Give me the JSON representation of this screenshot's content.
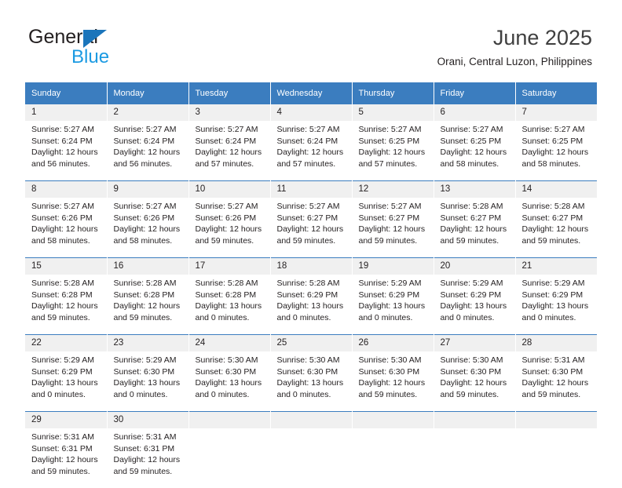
{
  "logo": {
    "word_primary": "General",
    "word_secondary": "Blue",
    "triangle_icon": "triangle-icon",
    "primary_color": "#231f20",
    "secondary_color": "#1b9ae2",
    "triangle_color": "#1b75bb"
  },
  "header": {
    "title": "June 2025",
    "subtitle": "Orani, Central Luzon, Philippines"
  },
  "theme": {
    "header_blue": "#3b7dbf",
    "daynum_gray": "#f0f0f0",
    "text": "#231f20"
  },
  "weekday_headers": [
    "Sunday",
    "Monday",
    "Tuesday",
    "Wednesday",
    "Thursday",
    "Friday",
    "Saturday"
  ],
  "weeks": [
    [
      {
        "day": "1",
        "sunrise": "Sunrise: 5:27 AM",
        "sunset": "Sunset: 6:24 PM",
        "daylight": "Daylight: 12 hours and 56 minutes."
      },
      {
        "day": "2",
        "sunrise": "Sunrise: 5:27 AM",
        "sunset": "Sunset: 6:24 PM",
        "daylight": "Daylight: 12 hours and 56 minutes."
      },
      {
        "day": "3",
        "sunrise": "Sunrise: 5:27 AM",
        "sunset": "Sunset: 6:24 PM",
        "daylight": "Daylight: 12 hours and 57 minutes."
      },
      {
        "day": "4",
        "sunrise": "Sunrise: 5:27 AM",
        "sunset": "Sunset: 6:24 PM",
        "daylight": "Daylight: 12 hours and 57 minutes."
      },
      {
        "day": "5",
        "sunrise": "Sunrise: 5:27 AM",
        "sunset": "Sunset: 6:25 PM",
        "daylight": "Daylight: 12 hours and 57 minutes."
      },
      {
        "day": "6",
        "sunrise": "Sunrise: 5:27 AM",
        "sunset": "Sunset: 6:25 PM",
        "daylight": "Daylight: 12 hours and 58 minutes."
      },
      {
        "day": "7",
        "sunrise": "Sunrise: 5:27 AM",
        "sunset": "Sunset: 6:25 PM",
        "daylight": "Daylight: 12 hours and 58 minutes."
      }
    ],
    [
      {
        "day": "8",
        "sunrise": "Sunrise: 5:27 AM",
        "sunset": "Sunset: 6:26 PM",
        "daylight": "Daylight: 12 hours and 58 minutes."
      },
      {
        "day": "9",
        "sunrise": "Sunrise: 5:27 AM",
        "sunset": "Sunset: 6:26 PM",
        "daylight": "Daylight: 12 hours and 58 minutes."
      },
      {
        "day": "10",
        "sunrise": "Sunrise: 5:27 AM",
        "sunset": "Sunset: 6:26 PM",
        "daylight": "Daylight: 12 hours and 59 minutes."
      },
      {
        "day": "11",
        "sunrise": "Sunrise: 5:27 AM",
        "sunset": "Sunset: 6:27 PM",
        "daylight": "Daylight: 12 hours and 59 minutes."
      },
      {
        "day": "12",
        "sunrise": "Sunrise: 5:27 AM",
        "sunset": "Sunset: 6:27 PM",
        "daylight": "Daylight: 12 hours and 59 minutes."
      },
      {
        "day": "13",
        "sunrise": "Sunrise: 5:28 AM",
        "sunset": "Sunset: 6:27 PM",
        "daylight": "Daylight: 12 hours and 59 minutes."
      },
      {
        "day": "14",
        "sunrise": "Sunrise: 5:28 AM",
        "sunset": "Sunset: 6:27 PM",
        "daylight": "Daylight: 12 hours and 59 minutes."
      }
    ],
    [
      {
        "day": "15",
        "sunrise": "Sunrise: 5:28 AM",
        "sunset": "Sunset: 6:28 PM",
        "daylight": "Daylight: 12 hours and 59 minutes."
      },
      {
        "day": "16",
        "sunrise": "Sunrise: 5:28 AM",
        "sunset": "Sunset: 6:28 PM",
        "daylight": "Daylight: 12 hours and 59 minutes."
      },
      {
        "day": "17",
        "sunrise": "Sunrise: 5:28 AM",
        "sunset": "Sunset: 6:28 PM",
        "daylight": "Daylight: 13 hours and 0 minutes."
      },
      {
        "day": "18",
        "sunrise": "Sunrise: 5:28 AM",
        "sunset": "Sunset: 6:29 PM",
        "daylight": "Daylight: 13 hours and 0 minutes."
      },
      {
        "day": "19",
        "sunrise": "Sunrise: 5:29 AM",
        "sunset": "Sunset: 6:29 PM",
        "daylight": "Daylight: 13 hours and 0 minutes."
      },
      {
        "day": "20",
        "sunrise": "Sunrise: 5:29 AM",
        "sunset": "Sunset: 6:29 PM",
        "daylight": "Daylight: 13 hours and 0 minutes."
      },
      {
        "day": "21",
        "sunrise": "Sunrise: 5:29 AM",
        "sunset": "Sunset: 6:29 PM",
        "daylight": "Daylight: 13 hours and 0 minutes."
      }
    ],
    [
      {
        "day": "22",
        "sunrise": "Sunrise: 5:29 AM",
        "sunset": "Sunset: 6:29 PM",
        "daylight": "Daylight: 13 hours and 0 minutes."
      },
      {
        "day": "23",
        "sunrise": "Sunrise: 5:29 AM",
        "sunset": "Sunset: 6:30 PM",
        "daylight": "Daylight: 13 hours and 0 minutes."
      },
      {
        "day": "24",
        "sunrise": "Sunrise: 5:30 AM",
        "sunset": "Sunset: 6:30 PM",
        "daylight": "Daylight: 13 hours and 0 minutes."
      },
      {
        "day": "25",
        "sunrise": "Sunrise: 5:30 AM",
        "sunset": "Sunset: 6:30 PM",
        "daylight": "Daylight: 13 hours and 0 minutes."
      },
      {
        "day": "26",
        "sunrise": "Sunrise: 5:30 AM",
        "sunset": "Sunset: 6:30 PM",
        "daylight": "Daylight: 12 hours and 59 minutes."
      },
      {
        "day": "27",
        "sunrise": "Sunrise: 5:30 AM",
        "sunset": "Sunset: 6:30 PM",
        "daylight": "Daylight: 12 hours and 59 minutes."
      },
      {
        "day": "28",
        "sunrise": "Sunrise: 5:31 AM",
        "sunset": "Sunset: 6:30 PM",
        "daylight": "Daylight: 12 hours and 59 minutes."
      }
    ],
    [
      {
        "day": "29",
        "sunrise": "Sunrise: 5:31 AM",
        "sunset": "Sunset: 6:31 PM",
        "daylight": "Daylight: 12 hours and 59 minutes."
      },
      {
        "day": "30",
        "sunrise": "Sunrise: 5:31 AM",
        "sunset": "Sunset: 6:31 PM",
        "daylight": "Daylight: 12 hours and 59 minutes."
      },
      {
        "day": "",
        "sunrise": "",
        "sunset": "",
        "daylight": ""
      },
      {
        "day": "",
        "sunrise": "",
        "sunset": "",
        "daylight": ""
      },
      {
        "day": "",
        "sunrise": "",
        "sunset": "",
        "daylight": ""
      },
      {
        "day": "",
        "sunrise": "",
        "sunset": "",
        "daylight": ""
      },
      {
        "day": "",
        "sunrise": "",
        "sunset": "",
        "daylight": ""
      }
    ]
  ]
}
